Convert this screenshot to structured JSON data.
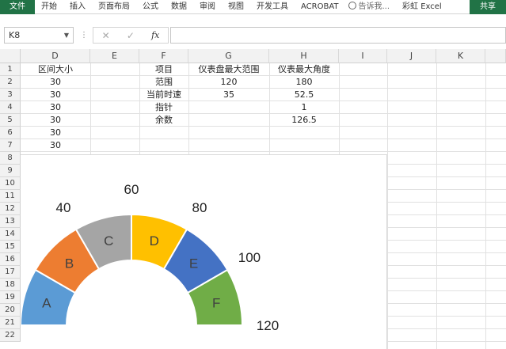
{
  "ribbon": {
    "tabs": [
      "文件",
      "开始",
      "插入",
      "页面布局",
      "公式",
      "数据",
      "审阅",
      "视图",
      "开发工具",
      "ACROBAT"
    ],
    "tell_me": "告诉我...",
    "account": "彩虹 Excel",
    "share": "共享"
  },
  "formula_bar": {
    "name_box": "K8",
    "fx_label": "fx",
    "value": ""
  },
  "columns": [
    "D",
    "E",
    "F",
    "G",
    "H",
    "I",
    "J",
    "K"
  ],
  "rows": [
    "1",
    "2",
    "3",
    "4",
    "5",
    "6",
    "7",
    "8",
    "9",
    "10",
    "11",
    "12",
    "13",
    "14",
    "15",
    "16",
    "17",
    "18",
    "19",
    "20",
    "21",
    "22"
  ],
  "cells": {
    "d1": "区间大小",
    "d_values": [
      "30",
      "30",
      "30",
      "30",
      "30",
      "30"
    ],
    "f_items": [
      "项目",
      "范围",
      "当前时速",
      "指针",
      "余数"
    ],
    "g_values": [
      "仪表盘最大范围",
      "120",
      "35",
      "",
      ""
    ],
    "h_values": [
      "仪表最大角度",
      "180",
      "52.5",
      "1",
      "126.5"
    ]
  },
  "chart_data": {
    "type": "pie",
    "semantics": "half-doughnut gauge, 6 equal bands of 30 degrees spanning 180 degrees",
    "segments": [
      {
        "label": "A",
        "value": 30,
        "color": "#5b9bd5"
      },
      {
        "label": "B",
        "value": 30,
        "color": "#ed7d31"
      },
      {
        "label": "C",
        "value": 30,
        "color": "#a5a5a5"
      },
      {
        "label": "D",
        "value": 30,
        "color": "#ffc000"
      },
      {
        "label": "E",
        "value": 30,
        "color": "#4472c4"
      },
      {
        "label": "F",
        "value": 30,
        "color": "#70ad47"
      }
    ],
    "scale_labels": [
      "40",
      "60",
      "80",
      "100",
      "120"
    ],
    "scale_values": [
      40,
      60,
      80,
      100,
      120
    ],
    "scale_max": 120
  }
}
